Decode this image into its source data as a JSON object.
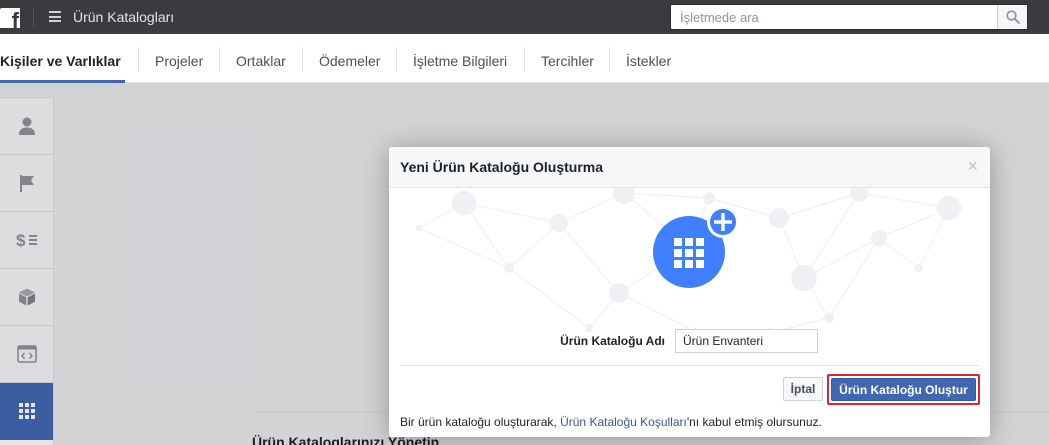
{
  "topbar": {
    "logo_letter": "f",
    "app_title": "Ürün Katalogları",
    "search_placeholder": "İşletmede ara"
  },
  "nav": {
    "tabs": [
      {
        "label": "Kişiler ve Varlıklar",
        "active": true
      },
      {
        "label": "Projeler",
        "active": false
      },
      {
        "label": "Ortaklar",
        "active": false
      },
      {
        "label": "Ödemeler",
        "active": false
      },
      {
        "label": "İşletme Bilgileri",
        "active": false
      },
      {
        "label": "Tercihler",
        "active": false
      },
      {
        "label": "İstekler",
        "active": false
      }
    ]
  },
  "sidebar": {
    "items": [
      {
        "icon": "person-icon",
        "active": false
      },
      {
        "icon": "flag-icon",
        "active": false
      },
      {
        "icon": "dollar-list-icon",
        "active": false
      },
      {
        "icon": "box-icon",
        "active": false
      },
      {
        "icon": "code-window-icon",
        "active": false
      },
      {
        "icon": "grid-icon",
        "active": true
      }
    ]
  },
  "main": {
    "section_heading": "Ürün Kataloglarınızı Yönetin"
  },
  "modal": {
    "title": "Yeni Ürün Kataloğu Oluşturma",
    "close_symbol": "×",
    "field_label": "Ürün Kataloğu Adı",
    "field_value": "Ürün Envanteri",
    "cancel_label": "İptal",
    "create_label": "Ürün Kataloğu Oluştur",
    "terms_prefix": "Bir ürün kataloğu oluşturarak, ",
    "terms_link": "Ürün Kataloğu Koşulları",
    "terms_suffix": "'nı kabul etmiş olursunuz."
  },
  "colors": {
    "topbar": "#3a3b3e",
    "accent": "#4267b2",
    "highlight_ring": "#d8262c",
    "link": "#365899"
  }
}
